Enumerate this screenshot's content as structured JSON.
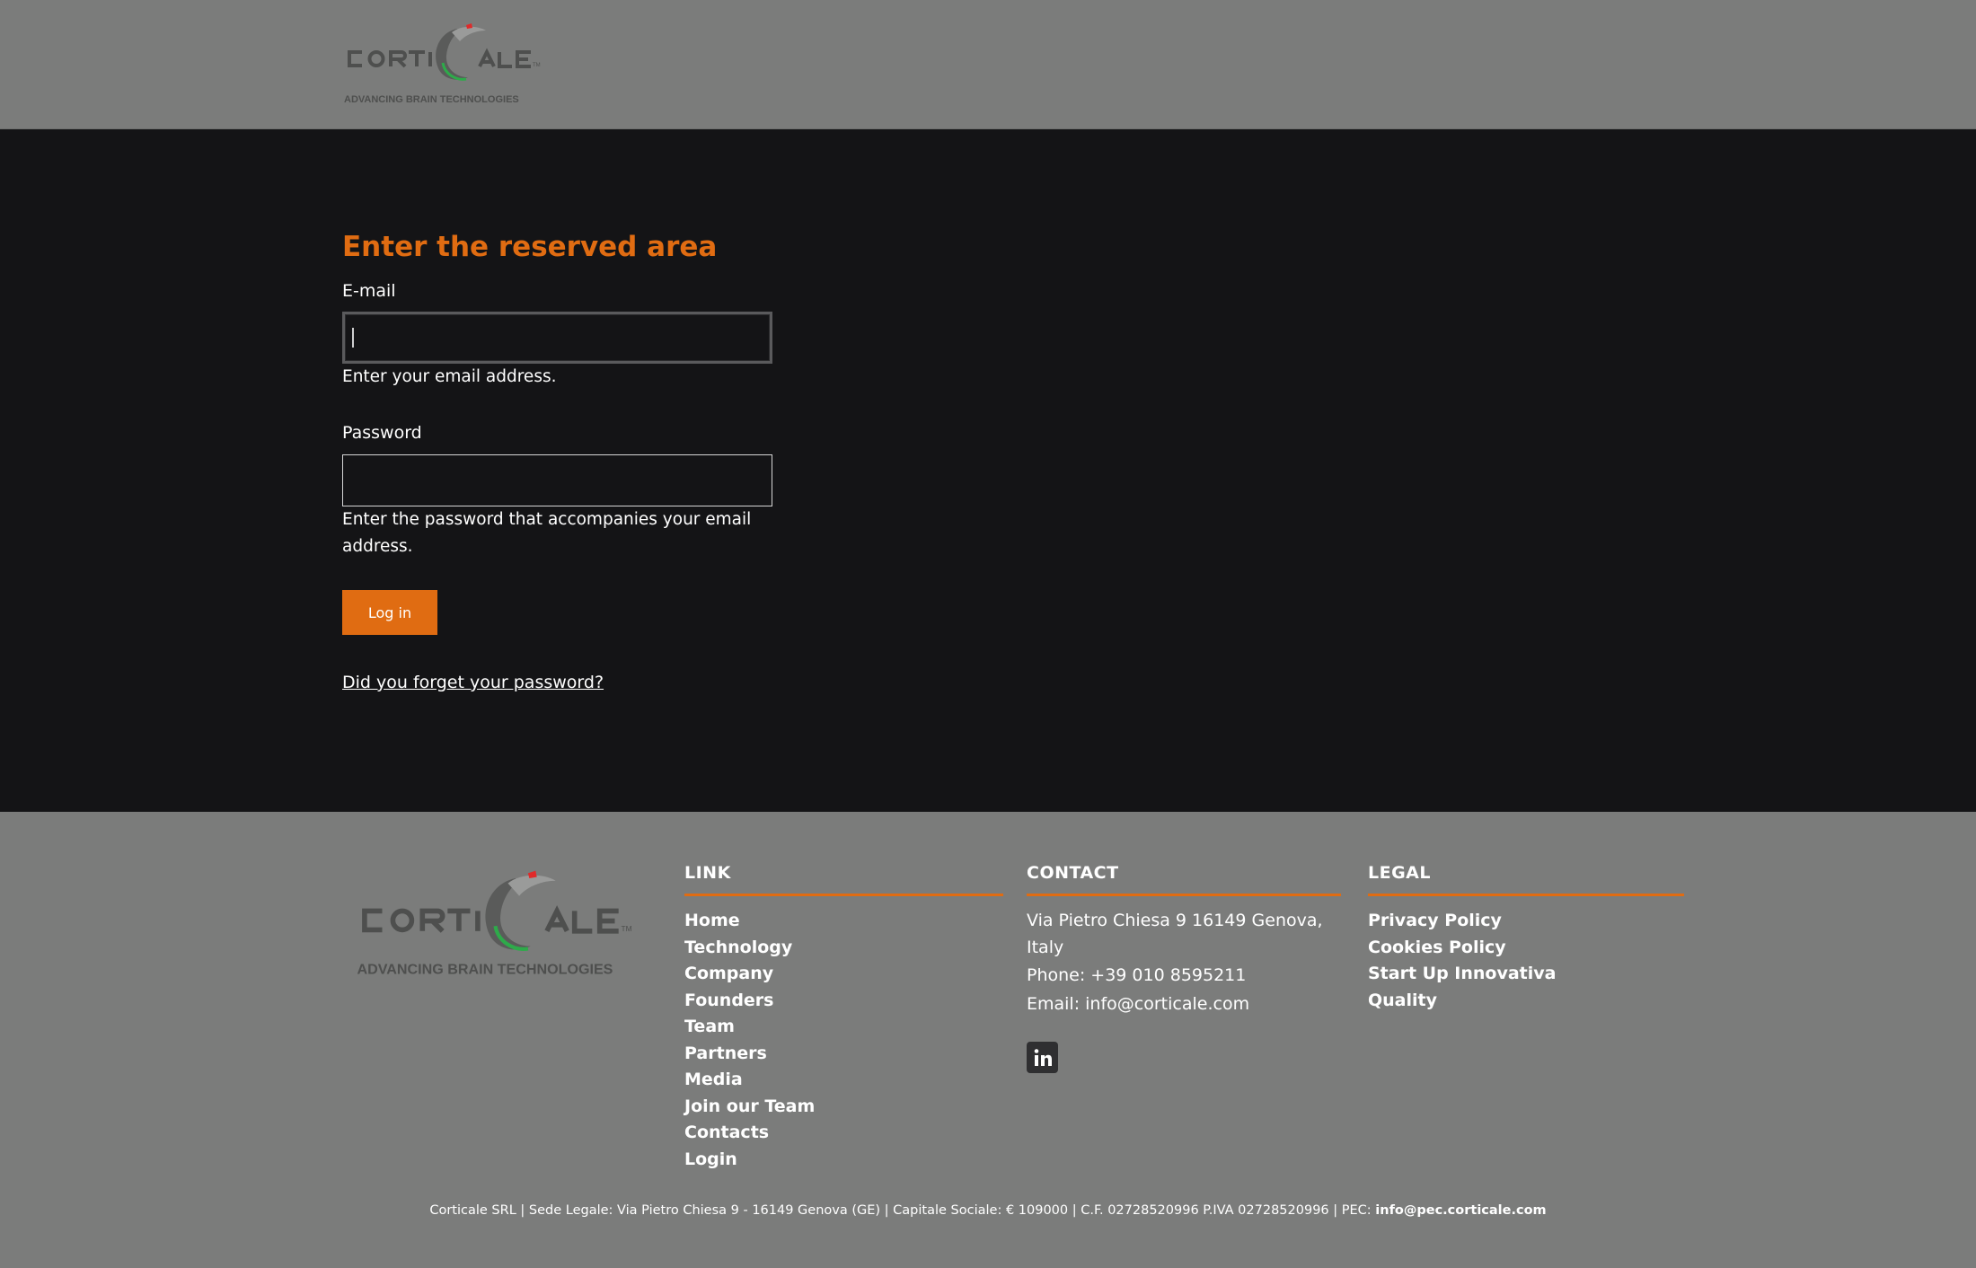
{
  "brand": {
    "name": "CORTICALE",
    "tagline": "ADVANCING BRAIN TECHNOLOGIES",
    "trademark": "TM",
    "colors": {
      "accent": "#e06c12",
      "green": "#2eaa4a",
      "red": "#e02a2a",
      "grey": "#4e4f4e"
    }
  },
  "login": {
    "title": "Enter the reserved area",
    "email_label": "E-mail",
    "email_value": "",
    "email_help": "Enter your email address.",
    "password_label": "Password",
    "password_value": "",
    "password_help": "Enter the password that accompanies your email address.",
    "submit_label": "Log in",
    "forgot_label": "Did you forget your password?"
  },
  "footer": {
    "link": {
      "title": "LINK",
      "items": [
        "Home",
        "Technology",
        "Company",
        "Founders",
        "Team",
        "Partners",
        "Media",
        "Join our Team",
        "Contacts",
        "Login"
      ]
    },
    "contact": {
      "title": "CONTACT",
      "address": "Via Pietro Chiesa 9 16149 Genova, Italy",
      "phone": "Phone: +39 010 8595211",
      "email": "Email: info@corticale.com",
      "social_icon": "linkedin-icon"
    },
    "legal": {
      "title": "LEGAL",
      "items": [
        "Privacy Policy",
        "Cookies Policy",
        "Start Up Innovativa",
        "Quality"
      ]
    },
    "company_info": "Corticale SRL | Sede Legale: Via Pietro Chiesa 9 - 16149 Genova (GE) | Capitale Sociale: € 109000 | C.F. 02728520996 P.IVA 02728520996 | PEC: ",
    "pec": "info@pec.corticale.com"
  }
}
